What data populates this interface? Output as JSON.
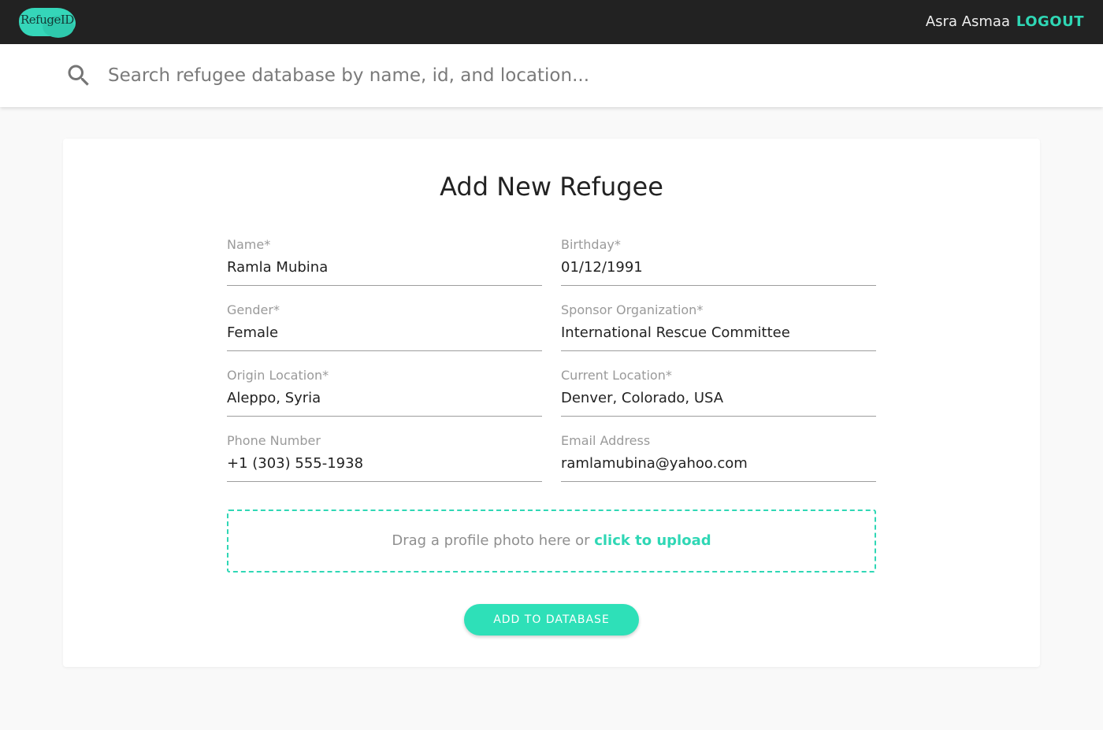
{
  "header": {
    "logo_text": "RefugeID",
    "user_name": "Asra Asmaa",
    "logout_label": "LOGOUT"
  },
  "search": {
    "icon": "search-icon",
    "placeholder": "Search refugee database by name, id, and location...",
    "value": ""
  },
  "form": {
    "title": "Add New Refugee",
    "fields": [
      {
        "label": "Name*",
        "value": "Ramla Mubina"
      },
      {
        "label": "Birthday*",
        "value": "01/12/1991"
      },
      {
        "label": "Gender*",
        "value": "Female"
      },
      {
        "label": "Sponsor Organization*",
        "value": "International Rescue Committee"
      },
      {
        "label": "Origin Location*",
        "value": "Aleppo, Syria"
      },
      {
        "label": "Current Location*",
        "value": "Denver, Colorado, USA"
      },
      {
        "label": "Phone Number",
        "value": "+1 (303) 555-1938"
      },
      {
        "label": "Email Address",
        "value": "ramlamubina@yahoo.com"
      }
    ],
    "dropzone_text": "Drag a profile photo here or ",
    "dropzone_link": "click to upload",
    "submit_label": "ADD TO DATABASE"
  },
  "colors": {
    "accent": "#2fd7b5",
    "topbar": "#222222",
    "background": "#f9f9f9"
  }
}
